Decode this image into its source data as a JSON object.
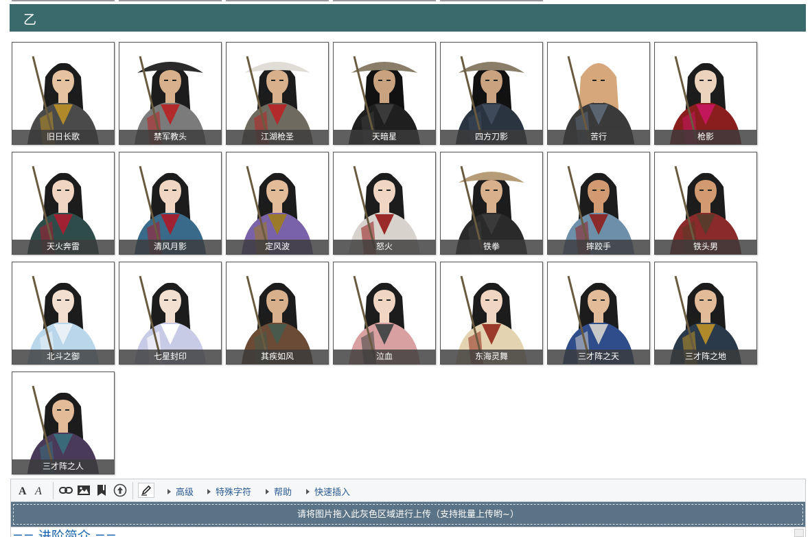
{
  "section": {
    "title": "乙"
  },
  "cards": [
    {
      "name": "旧日长歌",
      "palette": {
        "skin": "#e6c3a0",
        "hair": "#1c1c1c",
        "robe": "#4a4a4a",
        "accent": "#b08a2a",
        "hat": ""
      }
    },
    {
      "name": "禁军教头",
      "palette": {
        "skin": "#d9b08c",
        "hair": "#1c1c1c",
        "robe": "#7b7b7b",
        "accent": "#b22a2a",
        "hat": "#2b2b2b"
      }
    },
    {
      "name": "江湖枪圣",
      "palette": {
        "skin": "#d9b08c",
        "hair": "#1c1c1c",
        "robe": "#6f6a60",
        "accent": "#b22a2a",
        "hat": "#e0ddd6"
      }
    },
    {
      "name": "天暗星",
      "palette": {
        "skin": "#c9a27f",
        "hair": "#111111",
        "robe": "#1f1f1f",
        "accent": "#3a3a3a",
        "hat": "#8a7e68"
      }
    },
    {
      "name": "四方刀影",
      "palette": {
        "skin": "#c9a27f",
        "hair": "#111111",
        "robe": "#2a3340",
        "accent": "#3e4a5a",
        "hat": "#8a7e68"
      }
    },
    {
      "name": "苦行",
      "palette": {
        "skin": "#d6a77a",
        "hair": "#d6a77a",
        "robe": "#3a3a3a",
        "accent": "#5a6470",
        "hat": ""
      }
    },
    {
      "name": "枪影",
      "palette": {
        "skin": "#ecd3bd",
        "hair": "#1c1c1c",
        "robe": "#8a1e1e",
        "accent": "#c2185b",
        "hat": ""
      }
    },
    {
      "name": "天火奔雷",
      "palette": {
        "skin": "#f0d6c2",
        "hair": "#1c1c1c",
        "robe": "#2e4d4a",
        "accent": "#a02232",
        "hat": ""
      }
    },
    {
      "name": "清风月影",
      "palette": {
        "skin": "#f0d6c2",
        "hair": "#1c1c1c",
        "robe": "#3a6a8a",
        "accent": "#a02232",
        "hat": ""
      }
    },
    {
      "name": "定风波",
      "palette": {
        "skin": "#e2bb98",
        "hair": "#1c1c1c",
        "robe": "#7a62a8",
        "accent": "#9c7a2c",
        "hat": ""
      }
    },
    {
      "name": "怒火",
      "palette": {
        "skin": "#f0d6c2",
        "hair": "#1c1c1c",
        "robe": "#d7d2cc",
        "accent": "#9a2a2a",
        "hat": ""
      }
    },
    {
      "name": "铁拳",
      "palette": {
        "skin": "#d9b08c",
        "hair": "#1c1c1c",
        "robe": "#2a2a2a",
        "accent": "#3a3a3a",
        "hat": "#b79c78"
      }
    },
    {
      "name": "摔跤手",
      "palette": {
        "skin": "#d29a70",
        "hair": "#1c1c1c",
        "robe": "#6e8faa",
        "accent": "#8a2a2a",
        "hat": ""
      }
    },
    {
      "name": "铁头男",
      "palette": {
        "skin": "#d29a70",
        "hair": "#1c1c1c",
        "robe": "#8a2a2a",
        "accent": "#5a3a2a",
        "hat": ""
      }
    },
    {
      "name": "北斗之御",
      "palette": {
        "skin": "#f3dfd0",
        "hair": "#1c1c1c",
        "robe": "#b9d6ea",
        "accent": "#e8f1f7",
        "hat": ""
      }
    },
    {
      "name": "七星封印",
      "palette": {
        "skin": "#f3dfd0",
        "hair": "#1c1c1c",
        "robe": "#c7cbe6",
        "accent": "#ffffff",
        "hat": ""
      }
    },
    {
      "name": "其疾如风",
      "palette": {
        "skin": "#d9b08c",
        "hair": "#1c1c1c",
        "robe": "#6b4a36",
        "accent": "#4a5a4a",
        "hat": ""
      }
    },
    {
      "name": "泣血",
      "palette": {
        "skin": "#f0d6c2",
        "hair": "#1c1c1c",
        "robe": "#d8a0a0",
        "accent": "#4a4a4a",
        "hat": ""
      }
    },
    {
      "name": "东海灵舞",
      "palette": {
        "skin": "#f0d6c2",
        "hair": "#1c1c1c",
        "robe": "#e4d3b0",
        "accent": "#9a3a2a",
        "hat": ""
      }
    },
    {
      "name": "三才阵之天",
      "palette": {
        "skin": "#e2bb98",
        "hair": "#1c1c1c",
        "robe": "#2e4d8a",
        "accent": "#c8c8c8",
        "hat": ""
      }
    },
    {
      "name": "三才阵之地",
      "palette": {
        "skin": "#e2bb98",
        "hair": "#1c1c1c",
        "robe": "#2a3a4a",
        "accent": "#b08a2a",
        "hat": ""
      }
    },
    {
      "name": "三才阵之人",
      "palette": {
        "skin": "#e2bb98",
        "hair": "#1c1c1c",
        "robe": "#4a3a5a",
        "accent": "#3a6a7a",
        "hat": ""
      }
    }
  ],
  "toolbar": {
    "icons": [
      "bold-icon",
      "italic-icon",
      "link-icon",
      "image-icon",
      "bookmark-icon",
      "upload-icon",
      "pencil-icon"
    ],
    "links": [
      "高级",
      "特殊字符",
      "帮助",
      "快速插入"
    ]
  },
  "upload": {
    "text": "请将图片拖入此灰色区域进行上传（支持批量上传哟~）"
  },
  "editor": {
    "visible_text": "== 进阶简介 =="
  }
}
